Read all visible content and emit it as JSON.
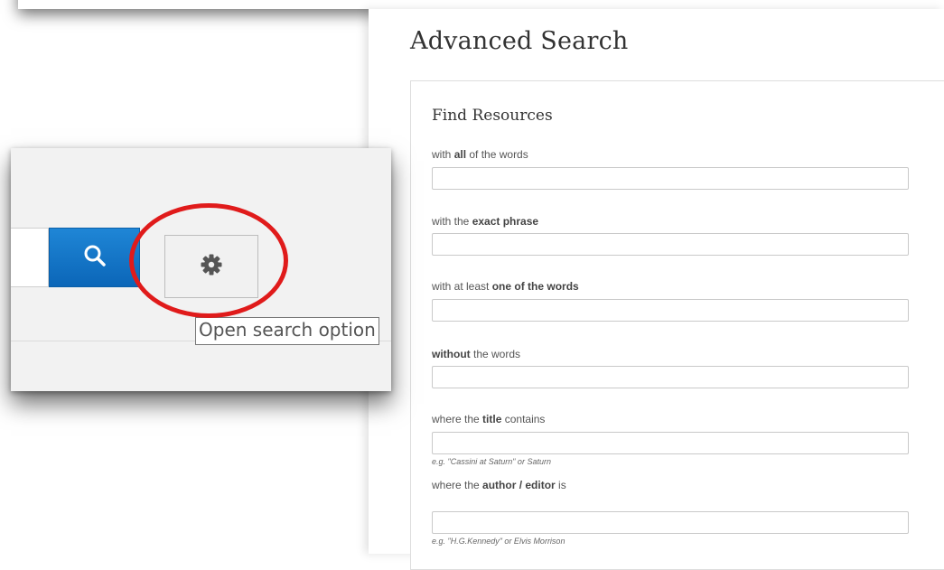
{
  "page": {
    "title": "Advanced Search",
    "panel_title": "Find Resources"
  },
  "fields": [
    {
      "label_pre": "with ",
      "label_bold": "all",
      "label_post": " of the words",
      "value": "",
      "hint": ""
    },
    {
      "label_pre": "with the ",
      "label_bold": "exact phrase",
      "label_post": "",
      "value": "",
      "hint": ""
    },
    {
      "label_pre": "with at least ",
      "label_bold": "one of the words",
      "label_post": "",
      "value": "",
      "hint": ""
    },
    {
      "label_pre": "",
      "label_bold": "without",
      "label_post": " the words",
      "value": "",
      "hint": ""
    },
    {
      "label_pre": "where the ",
      "label_bold": "title",
      "label_post": " contains",
      "value": "",
      "hint": "e.g. \"Cassini at Saturn\" or Saturn"
    },
    {
      "label_pre": "where the ",
      "label_bold": "author / editor",
      "label_post": " is",
      "value": "",
      "hint": "e.g. \"H.G.Kennedy\" or Elvis Morrison"
    }
  ],
  "inset": {
    "search_icon": "search-icon",
    "gear_icon": "gear-icon",
    "tooltip": "Open search option"
  },
  "colors": {
    "search_button": "#1476c6",
    "highlight": "#e01b1b"
  }
}
